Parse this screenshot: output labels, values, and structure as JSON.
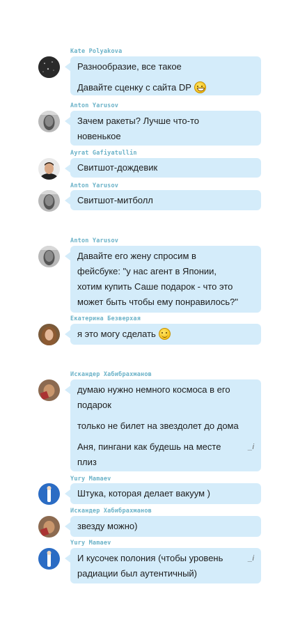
{
  "messages": [
    {
      "author": "Kate Polyakova",
      "avatar": "avatar-kate",
      "lines": [
        "Разнообразие, все такое",
        "Давайте сценку с сайта DP"
      ]
    },
    {
      "author": "Anton Yarusov",
      "avatar": "avatar-anton",
      "lines": [
        "Зачем ракеты? Лучше что-то",
        "новенькое"
      ]
    },
    {
      "author": "Ayrat Gafiyatullin",
      "avatar": "avatar-ayrat",
      "lines": [
        "Свитшот-дождевик"
      ]
    },
    {
      "author": "Anton Yarusov",
      "avatar": "avatar-anton",
      "lines": [
        "Свитшот-митболл"
      ]
    },
    {
      "author": "Anton Yarusov",
      "avatar": "avatar-anton",
      "lines": [
        "Давайте его жену спросим в",
        "фейсбуке: \"у нас агент в Японии,",
        "хотим купить Саше подарок - что это",
        "может быть чтобы ему понравилось?\""
      ]
    },
    {
      "author": "Екатерина Безверхая",
      "avatar": "avatar-ekaterina",
      "lines": [
        "я это могу сделать"
      ]
    },
    {
      "author": "Искандер Хабибрахманов",
      "avatar": "avatar-iskander",
      "lines": [
        "думаю нужно немного космоса в его",
        "подарок",
        "только не билет на звездолет до дома",
        "Аня, пингани как будешь на месте",
        "плиз"
      ],
      "edited_mark": "_i"
    },
    {
      "author": "Yury Mamaev",
      "avatar": "avatar-yury",
      "lines": [
        "Штука, которая делает вакуум )"
      ]
    },
    {
      "author": "Искандер Хабибрахманов",
      "avatar": "avatar-iskander",
      "lines": [
        "звезду можно)"
      ]
    },
    {
      "author": "Yury Mamaev",
      "avatar": "avatar-yury",
      "lines": [
        "И кусочек полония (чтобы уровень",
        "радиации был аутентичный)"
      ],
      "edited_mark": "_i"
    }
  ],
  "emoji": {
    "laugh": "laughing-face-emoji",
    "smile": "smiling-face-emoji"
  }
}
